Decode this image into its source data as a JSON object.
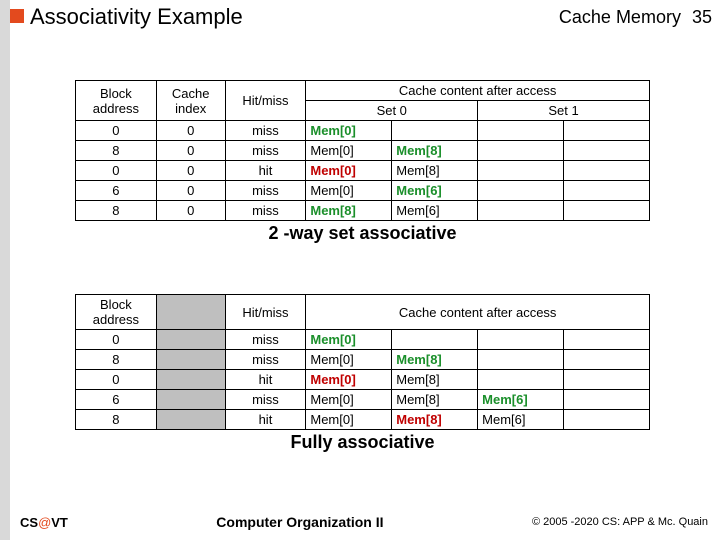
{
  "header": {
    "title": "Associativity Example",
    "section": "Cache Memory",
    "slideNo": "35"
  },
  "table1": {
    "headers": {
      "blockAddr": "Block address",
      "cacheIdx": "Cache index",
      "hitmiss": "Hit/miss",
      "cacheContent": "Cache content after access",
      "set0": "Set 0",
      "set1": "Set 1"
    },
    "rows": [
      {
        "ba": "0",
        "ci": "0",
        "hm": "miss",
        "c": [
          "Mem[0]",
          "",
          "",
          ""
        ],
        "cls": [
          "green",
          "",
          "",
          ""
        ]
      },
      {
        "ba": "8",
        "ci": "0",
        "hm": "miss",
        "c": [
          "Mem[0]",
          "Mem[8]",
          "",
          ""
        ],
        "cls": [
          "black",
          "green",
          "",
          ""
        ]
      },
      {
        "ba": "0",
        "ci": "0",
        "hm": "hit",
        "c": [
          "Mem[0]",
          "Mem[8]",
          "",
          ""
        ],
        "cls": [
          "red",
          "black",
          "",
          ""
        ]
      },
      {
        "ba": "6",
        "ci": "0",
        "hm": "miss",
        "c": [
          "Mem[0]",
          "Mem[6]",
          "",
          ""
        ],
        "cls": [
          "black",
          "green",
          "",
          ""
        ]
      },
      {
        "ba": "8",
        "ci": "0",
        "hm": "miss",
        "c": [
          "Mem[8]",
          "Mem[6]",
          "",
          ""
        ],
        "cls": [
          "green",
          "black",
          "",
          ""
        ]
      }
    ],
    "caption": "2 -way set associative"
  },
  "table2": {
    "headers": {
      "blockAddr": "Block address",
      "hitmiss": "Hit/miss",
      "cacheContent": "Cache content after access"
    },
    "rows": [
      {
        "ba": "0",
        "hm": "miss",
        "c": [
          "Mem[0]",
          "",
          "",
          ""
        ],
        "cls": [
          "green",
          "",
          "",
          ""
        ]
      },
      {
        "ba": "8",
        "hm": "miss",
        "c": [
          "Mem[0]",
          "Mem[8]",
          "",
          ""
        ],
        "cls": [
          "black",
          "green",
          "",
          ""
        ]
      },
      {
        "ba": "0",
        "hm": "hit",
        "c": [
          "Mem[0]",
          "Mem[8]",
          "",
          ""
        ],
        "cls": [
          "red",
          "black",
          "",
          ""
        ]
      },
      {
        "ba": "6",
        "hm": "miss",
        "c": [
          "Mem[0]",
          "Mem[8]",
          "Mem[6]",
          ""
        ],
        "cls": [
          "black",
          "black",
          "green",
          ""
        ]
      },
      {
        "ba": "8",
        "hm": "hit",
        "c": [
          "Mem[0]",
          "Mem[8]",
          "Mem[6]",
          ""
        ],
        "cls": [
          "black",
          "red",
          "black",
          ""
        ]
      }
    ],
    "caption": "Fully associative"
  },
  "footer": {
    "leftPre": "CS",
    "leftAt": "@",
    "leftPost": "VT",
    "center": "Computer Organization II",
    "right": "© 2005 -2020 CS: APP & Mc. Quain"
  }
}
